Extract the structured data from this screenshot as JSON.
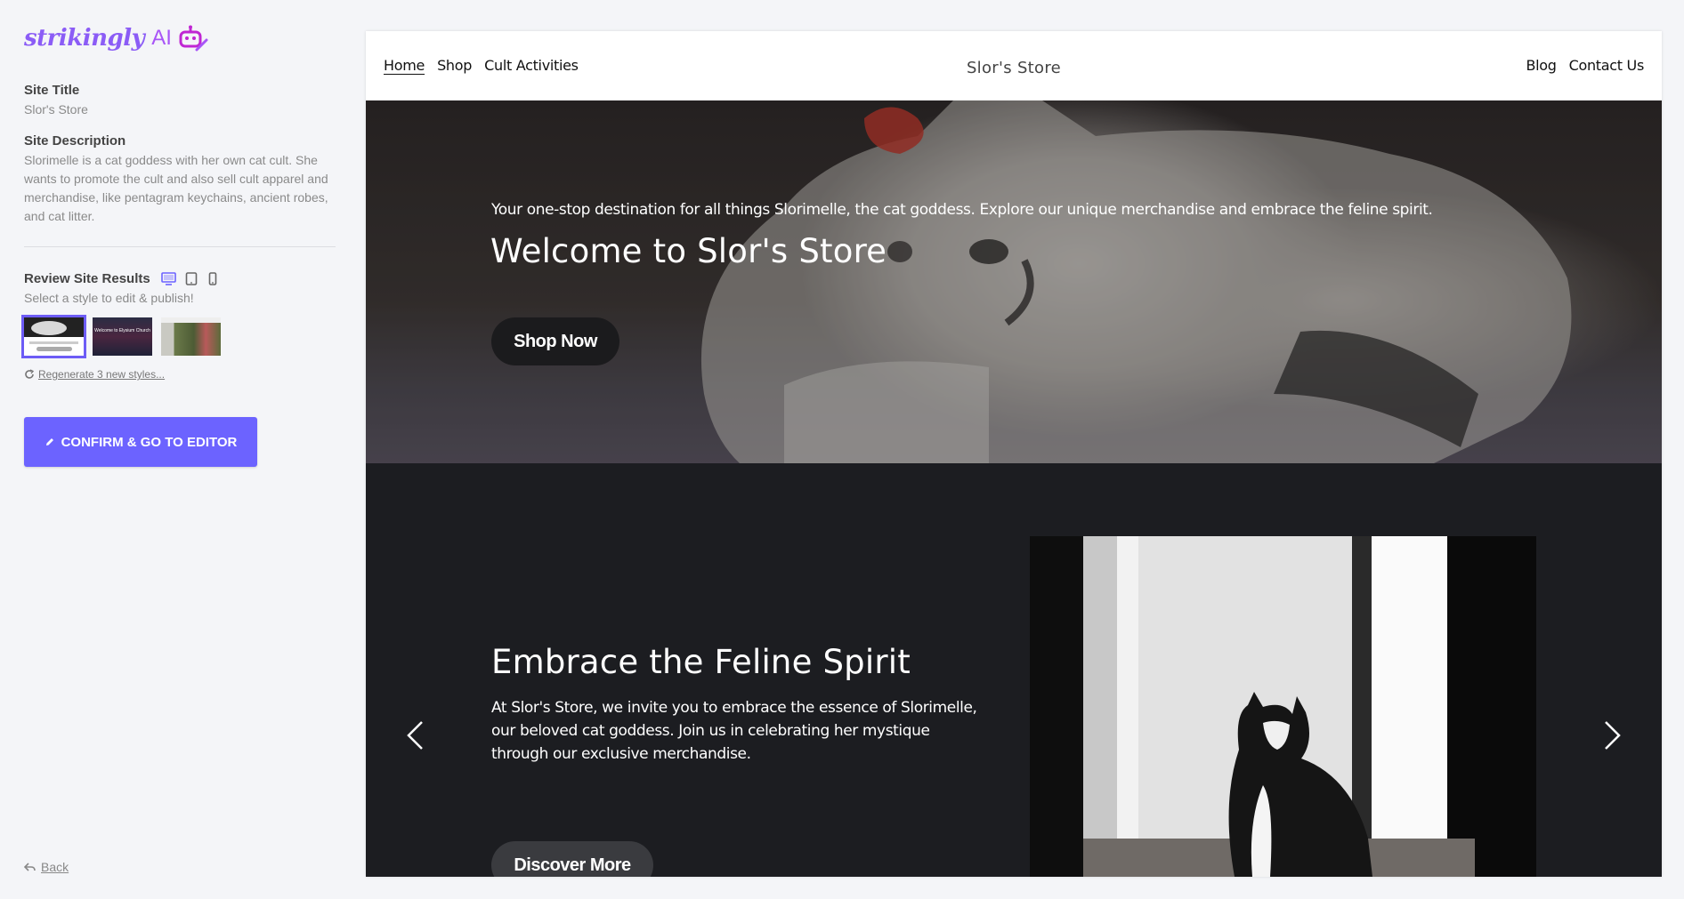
{
  "app": {
    "logo_word": "strikingly",
    "logo_ai": "AI",
    "brand_color": "#8b5cf6",
    "accent_color": "#6c63ff"
  },
  "sidebar": {
    "site_title_label": "Site Title",
    "site_title_value": "Slor's Store",
    "site_description_label": "Site Description",
    "site_description_value": "Slorimelle is a cat goddess with her own cat cult. She wants to promote the cult and also sell cult apparel and merchandise, like pentagram keychains, ancient robes, and cat litter.",
    "review_label": "Review Site Results",
    "review_hint": "Select a style to edit & publish!",
    "device_icons": [
      "desktop-icon",
      "tablet-icon",
      "mobile-icon"
    ],
    "style_thumbnails": [
      {
        "name": "style-1",
        "selected": true,
        "text": ""
      },
      {
        "name": "style-2",
        "selected": false,
        "text": "Welcome to Elysium Church"
      },
      {
        "name": "style-3",
        "selected": false,
        "text": ""
      }
    ],
    "regenerate_label": "Regenerate 3 new styles...",
    "confirm_label": "CONFIRM & GO TO EDITOR",
    "back_label": "Back"
  },
  "preview": {
    "nav": {
      "left_links": [
        "Home",
        "Shop",
        "Cult Activities"
      ],
      "active_link": "Home",
      "brand": "Slor's Store",
      "right_links": [
        "Blog",
        "Contact Us"
      ]
    },
    "hero": {
      "subtitle": "Your one-stop destination for all things Slorimelle, the cat goddess. Explore our unique merchandise and embrace the feline spirit.",
      "title": "Welcome to Slor's Store",
      "button": "Shop Now"
    },
    "section2": {
      "title": "Embrace the Feline Spirit",
      "text": "At Slor's Store, we invite you to embrace the essence of Slorimelle, our beloved cat goddess. Join us in celebrating her mystique through our exclusive merchandise.",
      "button": "Discover More"
    }
  }
}
